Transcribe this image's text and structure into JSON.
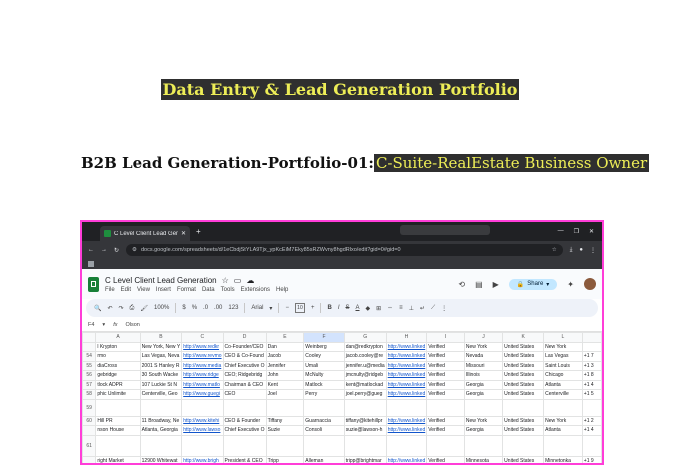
{
  "page": {
    "title": "Data Entry & Lead Generation Portfolio",
    "subtitle_prefix": "B2B Lead Generation-Portfolio-01:",
    "subtitle_highlight": "C-Suite-RealEstate Business Owner"
  },
  "browser": {
    "tab_title": "C Level Client Lead Generation",
    "new_tab": "+",
    "url": "docs.google.com/spreadsheets/d/1eCbdjStYLA9Tjx_ypKcEiM7Eky85sRZWvny8hgdRlxo/edit?gid=0#gid=0"
  },
  "sheets": {
    "doc_title": "C Level Client Lead Generation",
    "menus": [
      "File",
      "Edit",
      "View",
      "Insert",
      "Format",
      "Data",
      "Tools",
      "Extensions",
      "Help"
    ],
    "share_label": "Share",
    "zoom": "100%",
    "font": "Arial",
    "font_size": "10",
    "name_box": "F4",
    "formula": "Olson",
    "columns": [
      "A",
      "B",
      "C",
      "D",
      "E",
      "F",
      "G",
      "H",
      "I",
      "J",
      "K",
      "L",
      ""
    ],
    "rows": [
      {
        "n": "",
        "cells": [
          "l Krypton",
          "New York, New Y",
          "http://www.redkr",
          "Co-Founder/CEO",
          "Dan",
          "Weinberg",
          "dan@redkrypton",
          "http://www.linked",
          "Verified",
          "New York",
          "United States",
          "New York",
          ""
        ]
      },
      {
        "n": "54",
        "cells": [
          "rmo",
          "Las Vegas, Neva",
          "http://www.revmo",
          "CEO & Co-Found",
          "Jacob",
          "Cooley",
          "jacob.cooley@re",
          "http://www.linked",
          "Verified",
          "Nevada",
          "United States",
          "Las Vegas",
          "+1 7"
        ]
      },
      {
        "n": "55",
        "cells": [
          "diaCross",
          "2001 S Hanley R",
          "http://www.media",
          "Chief Executive O",
          "Jennifer",
          "Umali",
          "jennifer.u@media",
          "http://www.linked",
          "Verified",
          "Missouri",
          "United States",
          "Saint Louis",
          "+1 3"
        ]
      },
      {
        "n": "56",
        "cells": [
          "gebridge",
          "30 South Wacke",
          "http://www.ridge",
          "CEO; Ridgebridg",
          "John",
          "McNulty",
          "jmcnulty@ridgeb",
          "http://www.linked",
          "Verified",
          "Illinois",
          "United States",
          "Chicago",
          "+1 8"
        ]
      },
      {
        "n": "57",
        "cells": [
          "tlock ADPR",
          "107 Luckie St N",
          "http://www.matlo",
          "Chairman & CEO",
          "Kent",
          "Matlock",
          "kent@matlockad",
          "http://www.linked",
          "Verified",
          "Georgia",
          "United States",
          "Atlanta",
          "+1 4"
        ]
      },
      {
        "n": "58",
        "cells": [
          "phic Unlimite",
          "Centerville, Geo",
          "http://www.guegi",
          "CEO",
          "Joel",
          "Perry",
          "joel.perry@gueg",
          "http://www.linked",
          "Verified",
          "Georgia",
          "United States",
          "Centerville",
          "+1 5"
        ]
      },
      {
        "n": "59",
        "tall": true,
        "cells": [
          "",
          "",
          "",
          "",
          "",
          "",
          "",
          "",
          "",
          "",
          "",
          "",
          ""
        ]
      },
      {
        "n": "60",
        "cells": [
          "Hill PR",
          "11 Broadway, Ne",
          "http://www.kitehi",
          "CEO & Founder",
          "Tiffany",
          "Guarnaccia",
          "tiffany@kitehillpr",
          "http://www.linked",
          "Verified",
          "New York",
          "United States",
          "New York",
          "+1 2"
        ]
      },
      {
        "n": "",
        "cells": [
          "nson House",
          "Atlanta, Georgia",
          "http://www.lawso",
          "Chief Executive O",
          "Suzie",
          "Consoli",
          "suzie@lawson-h",
          "http://www.linked",
          "Verified",
          "Georgia",
          "United States",
          "Atlanta",
          "+1 4"
        ]
      },
      {
        "n": "61",
        "tall2": true,
        "cells": [
          "",
          "",
          "",
          "",
          "",
          "",
          "",
          "",
          "",
          "",
          "",
          "",
          ""
        ]
      },
      {
        "n": "",
        "cells": [
          "right Market",
          "12900 Whitewat",
          "http://www.brigh",
          "President & CEO",
          "Tripp",
          "Alleman",
          "tripp@brightmar",
          "http://www.linked",
          "Verified",
          "Minnesota",
          "United States",
          "Minnetonka",
          "+1 9"
        ]
      }
    ]
  },
  "colors": {
    "title_bg": "#2f2f2f",
    "title_text": "#eded57",
    "frame_border": "#ff3dd8",
    "link": "#1155cc"
  }
}
